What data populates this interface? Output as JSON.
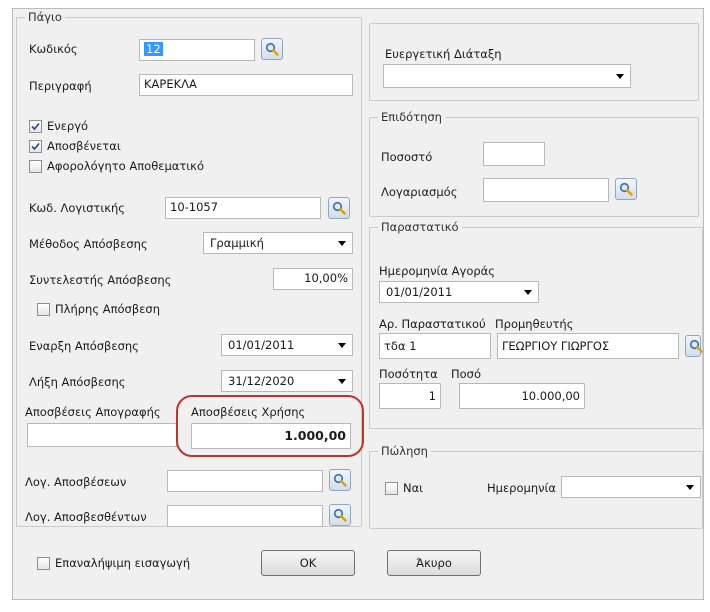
{
  "asset": {
    "title": "Πάγιο",
    "code_label": "Κωδικός",
    "code_value": "12",
    "description_label": "Περιγραφή",
    "description_value": "ΚΑΡΕΚΛΑ",
    "active_label": "Ενεργό",
    "active_checked": true,
    "depreciating_label": "Αποσβένεται",
    "depreciating_checked": true,
    "tax_free_label": "Αφορολόγητο Αποθεματικό",
    "tax_free_checked": false,
    "account_code_label": "Κωδ. Λογιστικής",
    "account_code_value": "10-1057",
    "method_label": "Μέθοδος Απόσβεσης",
    "method_value": "Γραμμική",
    "rate_label": "Συντελεστής Απόσβεσης",
    "rate_value": "10,00%",
    "full_depreciation_label": "Πλήρης Απόσβεση",
    "full_depreciation_checked": false,
    "start_label": "Εναρξη Απόσβεσης",
    "start_value": "01/01/2011",
    "end_label": "Λήξη Απόσβεσης",
    "end_value": "31/12/2020",
    "inventory_dep_label": "Αποσβέσεις Απογραφής",
    "inventory_dep_value": "",
    "usage_dep_label": "Αποσβέσεις Χρήσης",
    "usage_dep_value": "1.000,00",
    "dep_account_label": "Λογ. Αποσβέσεων",
    "dep_account_value": "",
    "depreciated_account_label": "Λογ. Αποσβεσθέντων",
    "depreciated_account_value": ""
  },
  "beneficial": {
    "label": "Ευεργετική Διάταξη",
    "value": ""
  },
  "subsidy": {
    "title": "Επιδότηση",
    "percent_label": "Ποσοστό",
    "percent_value": "",
    "account_label": "Λογαριασμός",
    "account_value": ""
  },
  "document": {
    "title": "Παραστατικό",
    "purchase_date_label": "Ημερομηνία Αγοράς",
    "purchase_date_value": "01/01/2011",
    "doc_no_label": "Αρ. Παραστατικού",
    "doc_no_value": "τδα 1",
    "supplier_label": "Προμηθευτής",
    "supplier_value": "ΓΕΩΡΓΙΟΥ ΓΙΩΡΓΟΣ",
    "quantity_label": "Ποσότητα",
    "quantity_value": "1",
    "amount_label": "Ποσό",
    "amount_value": "10.000,00"
  },
  "sale": {
    "title": "Πώληση",
    "yes_label": "Ναι",
    "yes_checked": false,
    "date_label": "Ημερομηνία",
    "date_value": ""
  },
  "footer": {
    "repeat_label": "Επαναλήψιμη εισαγωγή",
    "repeat_checked": false,
    "ok_label": "OK",
    "cancel_label": "Άκυρο"
  },
  "colors": {
    "highlight_ring": "#c0332b",
    "selection": "#3399ff",
    "dialog_bg": "#f0f0f0"
  }
}
